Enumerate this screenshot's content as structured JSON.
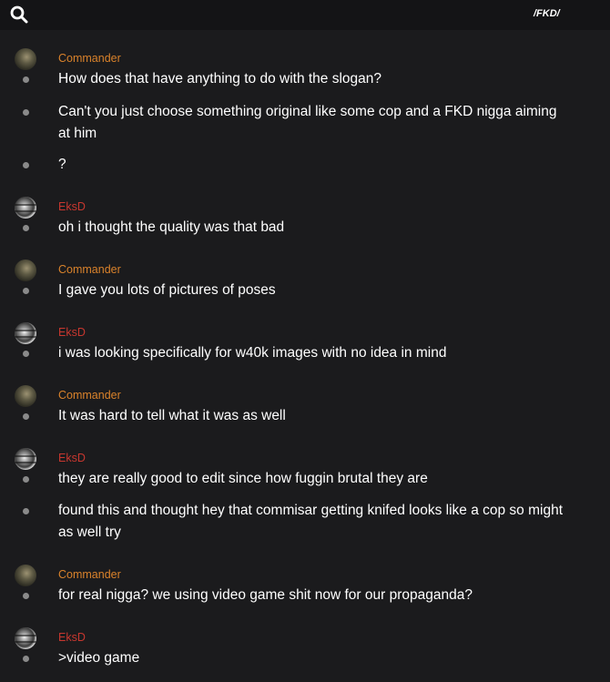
{
  "header": {
    "channel": "/FKD/",
    "icon": "search-icon"
  },
  "users": {
    "commander": {
      "name": "Commander",
      "color": "#d9822b"
    },
    "eksd": {
      "name": "EksD",
      "color": "#c7372f"
    }
  },
  "groups": [
    {
      "author": "Commander",
      "messages": [
        "How does that have anything to do with the slogan?",
        "Can't you just choose something original like some cop and a FKD nigga aiming at him",
        "?"
      ]
    },
    {
      "author": "EksD",
      "messages": [
        "oh i thought the quality was that bad"
      ]
    },
    {
      "author": "Commander",
      "messages": [
        "I gave you lots of pictures of poses"
      ]
    },
    {
      "author": "EksD",
      "messages": [
        "i was looking specifically for w40k images with no idea in mind"
      ]
    },
    {
      "author": "Commander",
      "messages": [
        "It was hard to tell what it was as well"
      ]
    },
    {
      "author": "EksD",
      "messages": [
        "they are really good to edit since how fuggin brutal they are",
        "found this and thought hey that commisar getting knifed looks like a cop so might as well try"
      ]
    },
    {
      "author": "Commander",
      "messages": [
        "for real nigga? we using video game shit now for our propaganda?"
      ]
    },
    {
      "author": "EksD",
      "messages": [
        ">video game"
      ]
    }
  ]
}
